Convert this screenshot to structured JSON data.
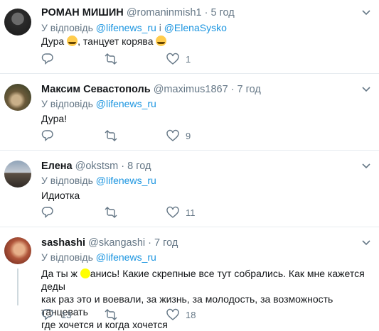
{
  "tweets": [
    {
      "name": "РОМАН МИШИН",
      "handle": "@romaninmish1",
      "time": "· 5 год",
      "reply_prefix": "У відповідь",
      "reply_to": [
        "@lifenews_ru",
        "@ElenaSysko"
      ],
      "reply_joiner": "і",
      "text_parts": [
        "Дура ",
        ", танцует корява "
      ],
      "replies": "",
      "retweets": "",
      "likes": "1"
    },
    {
      "name": "Максим Севастополь",
      "handle": "@maximus1867",
      "time": "· 7 год",
      "reply_prefix": "У відповідь",
      "reply_to": [
        "@lifenews_ru"
      ],
      "text": "Дура!",
      "replies": "",
      "retweets": "",
      "likes": "9"
    },
    {
      "name": "Елена",
      "handle": "@okstsm",
      "time": "· 8 год",
      "reply_prefix": "У відповідь",
      "reply_to": [
        "@lifenews_ru"
      ],
      "text": "Идиотка",
      "replies": "",
      "retweets": "",
      "likes": "11"
    },
    {
      "name": "sashashi",
      "handle": "@skangashi",
      "time": "· 7 год",
      "reply_prefix": "У відповідь",
      "reply_to": [
        "@lifenews_ru"
      ],
      "text_lines": [
        "Да ты ж",
        "анись! Какие скрепные все тут собрались. Как мне кажется деды",
        "как раз это и воевали, за жизнь, за молодость, за возможность танцевать",
        "где хочется и когда хочется"
      ],
      "replies": "13",
      "retweets": "",
      "likes": "18"
    }
  ],
  "icons": {
    "reply": "reply-icon",
    "retweet": "retweet-icon",
    "like": "like-icon",
    "more": "chevron-down-icon",
    "emoji": "tears-of-joy-emoji"
  },
  "colors": {
    "link": "#1b95e0",
    "secondary": "#657786",
    "text": "#14171a",
    "divider": "#e6ecf0",
    "highlight": "#ffff00"
  }
}
